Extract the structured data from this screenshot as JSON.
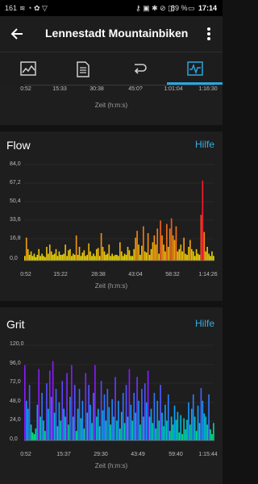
{
  "status_bar": {
    "left": "161",
    "battery": "89 %",
    "time": "17:14"
  },
  "header": {
    "title": "Lennestadt Mountainbiken",
    "back_icon": "back-arrow-icon",
    "menu_icon": "more-vert-icon"
  },
  "tabs": [
    {
      "icon": "map-icon",
      "active": false
    },
    {
      "icon": "details-icon",
      "active": false
    },
    {
      "icon": "laps-icon",
      "active": false
    },
    {
      "icon": "charts-icon",
      "active": true
    }
  ],
  "colors": {
    "accent": "#2aa7e0",
    "flow_low": "#e6ee00",
    "flow_high": "#ff1a2a",
    "grit_low": "#00ff55",
    "grit_mid": "#00a8ff",
    "grit_high": "#8a1aff"
  },
  "top_partial": {
    "xticks": [
      "0:52",
      "15:33",
      "30:38",
      "45:0?",
      "1:01:04",
      "1:16:30"
    ],
    "xlabel": "Zeit (h:m:s)"
  },
  "flow": {
    "title": "Flow",
    "help": "Hilfe",
    "xlabel": "Zeit (h:m:s)",
    "yticks": [
      "84,0",
      "67,2",
      "50,4",
      "33,6",
      "16,8",
      "0,0"
    ],
    "xticks": [
      "0:52",
      "15:22",
      "28:38",
      "43:04",
      "58:32",
      "1:14:26"
    ],
    "chart_data": {
      "type": "bar",
      "ylim": [
        0,
        84
      ],
      "x_range": [
        "0:52",
        "1:18:00"
      ],
      "values": [
        4,
        20,
        10,
        5,
        8,
        4,
        6,
        3,
        5,
        10,
        4,
        6,
        4,
        3,
        12,
        6,
        14,
        8,
        5,
        6,
        10,
        4,
        8,
        5,
        5,
        6,
        14,
        4,
        9,
        10,
        4,
        6,
        5,
        22,
        5,
        12,
        4,
        7,
        9,
        4,
        5,
        15,
        8,
        4,
        6,
        4,
        10,
        11,
        4,
        24,
        12,
        8,
        5,
        6,
        14,
        4,
        6,
        4,
        5,
        5,
        4,
        16,
        8,
        4,
        6,
        5,
        12,
        9,
        4,
        4,
        10,
        20,
        26,
        14,
        5,
        13,
        30,
        8,
        7,
        24,
        5,
        10,
        16,
        22,
        14,
        28,
        6,
        35,
        22,
        14,
        8,
        32,
        12,
        28,
        37,
        22,
        18,
        30,
        8,
        10,
        14,
        8,
        20,
        6,
        5,
        12,
        18,
        10,
        8,
        4,
        10,
        6,
        5,
        40,
        70,
        25,
        8,
        12,
        6,
        4,
        8,
        4
      ]
    }
  },
  "grit": {
    "title": "Grit",
    "help": "Hilfe",
    "xlabel": "Zeit (h:m:s)",
    "yticks": [
      "120,0",
      "96,0",
      "72,0",
      "48,0",
      "24,0",
      "0,0"
    ],
    "xticks": [
      "0:52",
      "15:37",
      "29:30",
      "43:49",
      "59:40",
      "1:15:44"
    ],
    "chart_data": {
      "type": "bar",
      "ylim": [
        0,
        120
      ],
      "x_range": [
        "0:52",
        "1:18:00"
      ],
      "values": [
        95,
        50,
        40,
        70,
        20,
        10,
        8,
        15,
        45,
        90,
        30,
        60,
        25,
        12,
        72,
        40,
        88,
        55,
        100,
        35,
        65,
        18,
        48,
        25,
        75,
        40,
        30,
        85,
        20,
        55,
        95,
        30,
        70,
        12,
        40,
        65,
        28,
        50,
        15,
        85,
        35,
        70,
        45,
        22,
        60,
        95,
        30,
        40,
        18,
        75,
        38,
        58,
        25,
        65,
        42,
        20,
        52,
        30,
        80,
        25,
        50,
        15,
        36,
        60,
        22,
        70,
        30,
        90,
        45,
        25,
        60,
        35,
        80,
        50,
        20,
        65,
        30,
        72,
        48,
        88,
        30,
        40,
        22,
        60,
        15,
        50,
        25,
        70,
        35,
        18,
        45,
        25,
        58,
        12,
        30,
        20,
        44,
        26,
        36,
        10,
        32,
        8,
        28,
        14,
        26,
        48,
        20,
        40,
        58,
        30,
        12,
        44,
        22,
        66,
        50,
        34,
        30,
        20,
        58,
        14,
        8,
        22
      ]
    }
  }
}
